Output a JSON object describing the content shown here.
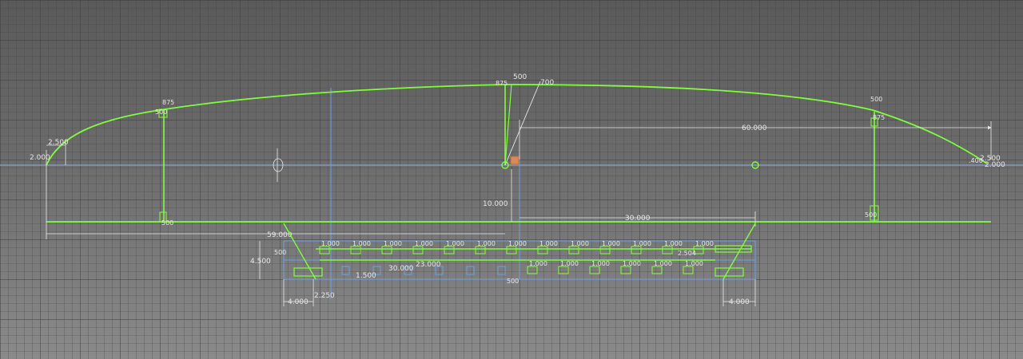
{
  "colors": {
    "grid_minor": "#4a4a4a",
    "grid_major": "#3a3a3a",
    "axis": "#7fa6d9",
    "geometry": "#7fff3a",
    "dimension": "#e6e6e6",
    "blue_line": "#6ea0e0",
    "selected_point": "#d98a5a"
  },
  "top_dimensions": {
    "d_875_left": "875",
    "d_500_left": "500",
    "d_500_center": "500",
    "d_875_center": "875",
    "d_700": "700",
    "d_500_right": "500",
    "d_875_right": "875",
    "d_2500_left": "2.500",
    "d_2000_left": "2.000",
    "d_60000": "60.000",
    "d_2500_right": "2.500",
    "d_2000_right": "2.000",
    "d_400_right": ".400",
    "d_10000": "10.000",
    "d_30000_right": "30.000",
    "d_500_low_right": "500",
    "d_500_low_left": "500"
  },
  "bottom_dimensions": {
    "d_59000": "59.000",
    "d_4500": "4.500",
    "d_500_a": "500",
    "d_500_b": "500",
    "d_1000": "1.000",
    "d_30000": "30.000",
    "d_23000": "23.000",
    "d_1500": "1.500",
    "d_4000_left": "4.000",
    "d_2250": "2.250",
    "d_4000_right": "4.000",
    "d_500_center": "500",
    "d_2504": "2.504"
  }
}
